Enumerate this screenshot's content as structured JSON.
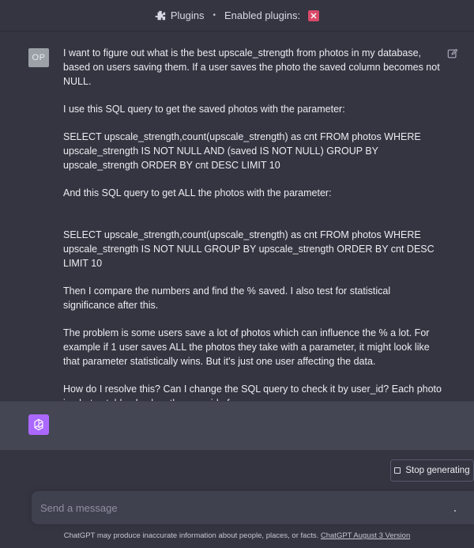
{
  "topbar": {
    "plugins_label": "Plugins",
    "separator": "•",
    "enabled_label": "Enabled plugins:",
    "plugin_icon": "plugin-badge-icon",
    "plugin_color": "#d94a69"
  },
  "user_message": {
    "avatar_initials": "OP",
    "paragraphs": [
      "I want to figure out what is the best upscale_strength from photos in my database, based on users saving them. If a user saves the photo the saved column becomes not NULL.",
      "I use this SQL query to get the saved photos with the parameter:",
      "SELECT upscale_strength,count(upscale_strength) as cnt FROM photos WHERE upscale_strength IS NOT NULL AND (saved IS NOT NULL) GROUP BY upscale_strength ORDER BY cnt DESC LIMIT 10",
      "And this SQL query to get ALL the photos with the parameter:",
      "SELECT upscale_strength,count(upscale_strength) as cnt FROM photos WHERE upscale_strength IS NOT NULL GROUP BY upscale_strength ORDER BY cnt DESC LIMIT 10",
      "Then I compare the numbers and find the % saved. I also test for statistical significance after this.",
      "The problem is some users save a lot of photos which can influence the % a lot. For example if 1 user saves ALL the photos they take with a parameter, it might look like that parameter statistically wins. But it's just one user affecting the data.",
      "How do I resolve this? Can I change the SQL query to check it by user_id? Each photo in photos table also has the user_id of course."
    ]
  },
  "assistant": {
    "logo_icon": "openai-logo-icon",
    "logo_color": "#ab68ff"
  },
  "controls": {
    "stop_label": "Stop generating"
  },
  "composer": {
    "placeholder": "Send a message",
    "value": ""
  },
  "footer": {
    "text": "ChatGPT may produce inaccurate information about people, places, or facts.",
    "link": "ChatGPT August 3 Version"
  },
  "colors": {
    "background": "#343541",
    "assistant_background": "#444654",
    "composer_background": "#40414f"
  }
}
